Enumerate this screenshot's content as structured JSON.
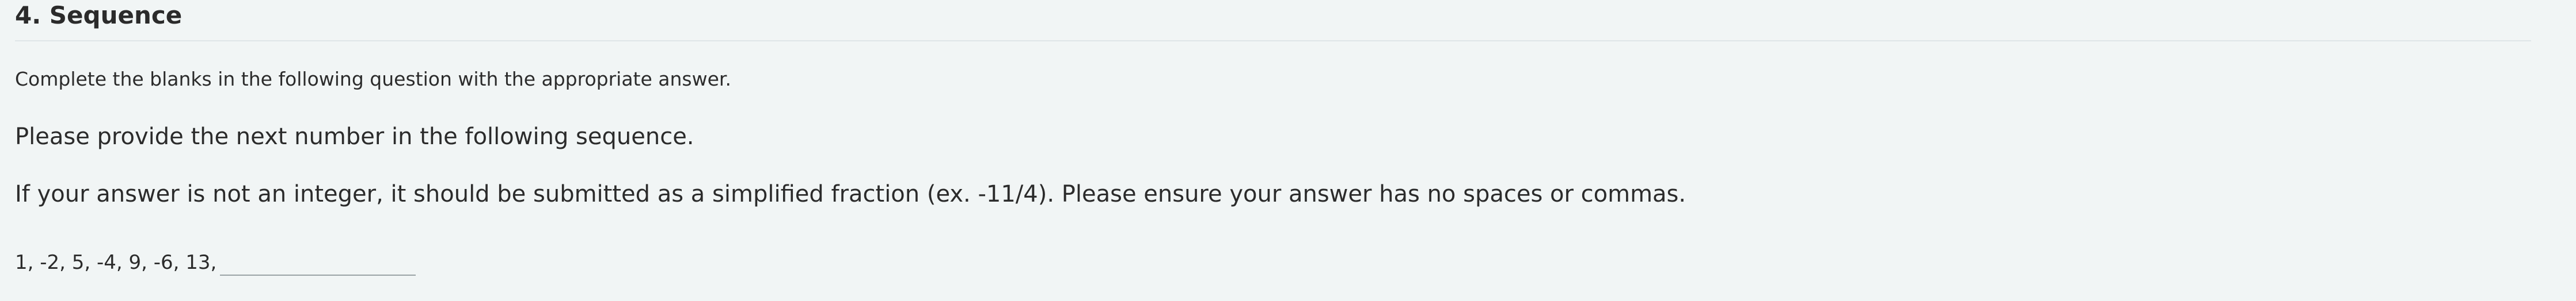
{
  "section": {
    "title": "4. Sequence"
  },
  "question": {
    "instruction": "Complete the blanks in the following question with the appropriate answer.",
    "prompt": "Please provide the next number in the following sequence.",
    "note": "If your answer is not an integer, it should be submitted as a simplified fraction (ex. -11/4). Please ensure your answer has no spaces or commas.",
    "sequence": "1, -2, 5, -4, 9, -6, 13,",
    "answer_value": ""
  }
}
